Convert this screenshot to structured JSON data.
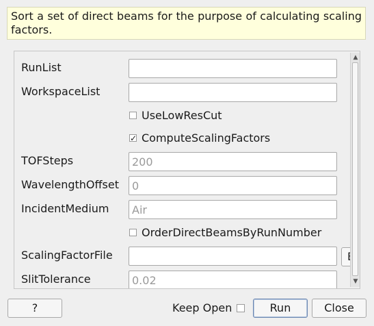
{
  "description": "Sort a set of direct beams for the purpose of calculating scaling factors.",
  "fields": {
    "run_list": {
      "label": "RunList",
      "value": ""
    },
    "workspace_list": {
      "label": "WorkspaceList",
      "value": ""
    },
    "use_low_res_cut": {
      "label": "UseLowResCut",
      "checked": false
    },
    "compute_scaling_factors": {
      "label": "ComputeScalingFactors",
      "checked": true,
      "check_mark": "✓"
    },
    "tof_steps": {
      "label": "TOFSteps",
      "placeholder": "200"
    },
    "wavelength_offset": {
      "label": "WavelengthOffset",
      "placeholder": "0"
    },
    "incident_medium": {
      "label": "IncidentMedium",
      "placeholder": "Air"
    },
    "order_direct_beams": {
      "label": "OrderDirectBeamsByRunNumber",
      "checked": false
    },
    "scaling_factor_file": {
      "label": "ScalingFactorFile",
      "value": "",
      "browse_label": "B"
    },
    "slit_tolerance": {
      "label": "SlitTolerance",
      "placeholder": "0.02"
    }
  },
  "scrollbar": {
    "up_icon": "▲",
    "down_icon": "▼"
  },
  "footer": {
    "help_label": "?",
    "keep_open_label": "Keep Open",
    "keep_open_checked": false,
    "run_label": "Run",
    "close_label": "Close"
  }
}
